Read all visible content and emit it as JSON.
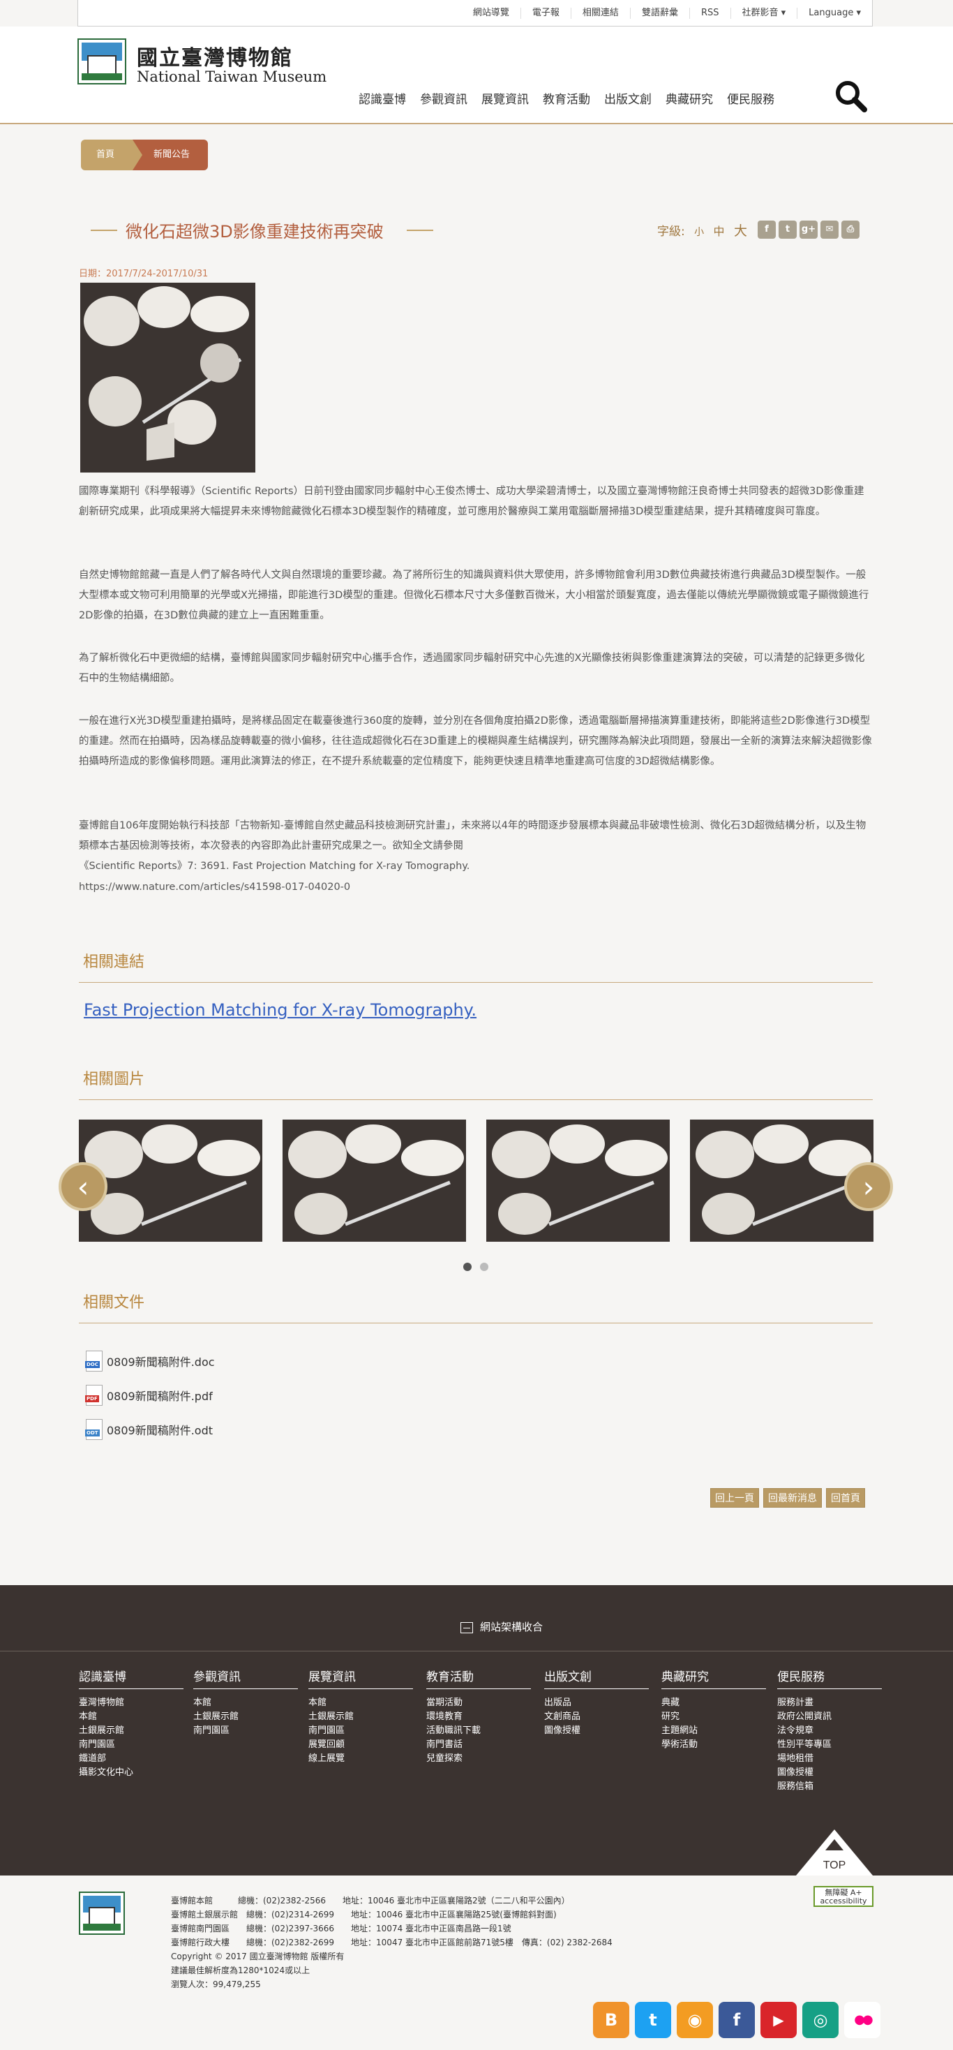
{
  "topbar": {
    "items": [
      "網站導覽",
      "電子報",
      "相關連結",
      "雙語辭彙",
      "RSS",
      "社群影音 ▾",
      "Language ▾"
    ]
  },
  "brand": {
    "name_cn": "國立臺灣博物館",
    "name_en": "National Taiwan Museum"
  },
  "nav": {
    "items": [
      "認識臺博",
      "參觀資訊",
      "展覽資訊",
      "教育活動",
      "出版文創",
      "典藏研究",
      "便民服務"
    ]
  },
  "breadcrumb": {
    "home": "首頁",
    "current": "新聞公告"
  },
  "article": {
    "title": "微化石超微3D影像重建技術再突破",
    "font_label": "字級:",
    "font_small": "小",
    "font_medium": "中",
    "font_large": "大",
    "date": "日期：2017/7/24-2017/10/31",
    "p1": "國際專業期刊《科學報導》（Scientific Reports）日前刊登由國家同步輻射中心王俊杰博士、成功大學梁碧清博士，以及國立臺灣博物館汪良奇博士共同發表的超微3D影像重建創新研究成果，此項成果將大幅提昇未來博物館藏微化石標本3D模型製作的精確度，並可應用於醫療與工業用電腦斷層掃描3D模型重建結果，提升其精確度與可靠度。",
    "p2": "自然史博物館館藏一直是人們了解各時代人文與自然環境的重要珍藏。為了將所衍生的知識與資料供大眾使用，許多博物館會利用3D數位典藏技術進行典藏品3D模型製作。一般大型標本或文物可利用簡單的光學或X光掃描，即能進行3D模型的重建。但微化石標本尺寸大多僅數百微米，大小相當於頭髮寬度，過去僅能以傳統光學顯微鏡或電子顯微鏡進行2D影像的拍攝，在3D數位典藏的建立上一直困難重重。",
    "p3": "為了解析微化石中更微細的結構，臺博館與國家同步輻射研究中心攜手合作，透過國家同步輻射研究中心先進的X光顯像技術與影像重建演算法的突破，可以清楚的記錄更多微化石中的生物結構細節。",
    "p4": "一般在進行X光3D模型重建拍攝時，是將樣品固定在載臺後進行360度的旋轉，並分別在各個角度拍攝2D影像，透過電腦斷層掃描演算重建技術，即能將這些2D影像進行3D模型的重建。然而在拍攝時，因為樣品旋轉載臺的微小偏移，往往造成超微化石在3D重建上的模糊與產生結構誤判，研究團隊為解決此項問題，發展出一全新的演算法來解決超微影像拍攝時所造成的影像偏移問題。運用此演算法的修正，在不提升系統載臺的定位精度下，能夠更快速且精準地重建高可信度的3D超微結構影像。",
    "p5": "臺博館自106年度開始執行科技部「古物新知-臺博館自然史藏品科技檢測研究計畫」，未來將以4年的時間逐步發展標本與藏品非破壞性檢測、微化石3D超微結構分析，以及生物類標本古基因檢測等技術，本次發表的內容即為此計畫研究成果之一。欲知全文請參閱",
    "ref": "《Scientific Reports》7: 3691. Fast Projection Matching for X-ray Tomography.",
    "url": "https://www.nature.com/articles/s41598-017-04020-0"
  },
  "related_links": {
    "heading": "相關連結",
    "items": [
      "Fast Projection Matching for X-ray Tomography."
    ]
  },
  "related_images": {
    "heading": "相關圖片"
  },
  "related_docs": {
    "heading": "相關文件",
    "items": [
      {
        "name": "0809新聞稿附件.doc",
        "type": "DOC",
        "color": "#2b6cc4"
      },
      {
        "name": "0809新聞稿附件.pdf",
        "type": "PDF",
        "color": "#d0312d"
      },
      {
        "name": "0809新聞稿附件.odt",
        "type": "ODT",
        "color": "#3a82c8"
      }
    ]
  },
  "page_nav": {
    "prev": "回上一頁",
    "list": "回最新消息",
    "home": "回首頁"
  },
  "footer": {
    "collapse": "網站架構收合",
    "columns": [
      {
        "title": "認識臺博",
        "items": [
          "臺灣博物館",
          "本館",
          "土銀展示館",
          "南門園區",
          "鐵道部",
          "攝影文化中心"
        ]
      },
      {
        "title": "參觀資訊",
        "items": [
          "本館",
          "土銀展示館",
          "南門園區"
        ]
      },
      {
        "title": "展覽資訊",
        "items": [
          "本館",
          "土銀展示館",
          "南門園區",
          "展覽回顧",
          "線上展覽"
        ]
      },
      {
        "title": "教育活動",
        "items": [
          "當期活動",
          "環境教育",
          "活動職訊下載",
          "南門書話",
          "兒童探索"
        ]
      },
      {
        "title": "出版文創",
        "items": [
          "出版品",
          "文創商品",
          "圖像授權"
        ]
      },
      {
        "title": "典藏研究",
        "items": [
          "典藏",
          "研究",
          "主題網站",
          "學術活動"
        ]
      },
      {
        "title": "便民服務",
        "items": [
          "服務計畫",
          "政府公開資訊",
          "法令規章",
          "性別平等專區",
          "場地租借",
          "圖像授權",
          "服務信箱"
        ]
      }
    ],
    "top_label": "TOP",
    "info": [
      "臺博館本館　　　總機：(02)2382-2566　　地址：10046 臺北市中正區襄陽路2號（二二八和平公園內）",
      "臺博館土銀展示館　總機：(02)2314-2699　　地址：10046 臺北市中正區襄陽路25號(臺博館斜對面)",
      "臺博館南門園區　　總機：(02)2397-3666　　地址：10074 臺北市中正區南昌路一段1號",
      "臺博館行政大樓　　總機：(02)2382-2699　　地址：10047 臺北市中正區館前路71號5樓　傳真：(02) 2382-2684",
      "Copyright © 2017 國立臺灣博物館 版權所有",
      "建議最佳解析度為1280*1024或以上",
      "瀏覽人次：99,479,255"
    ],
    "accessibility": "無障礙 A+ accessibility",
    "socials": [
      {
        "name": "blogger",
        "glyph": "B",
        "color": "#f0932b"
      },
      {
        "name": "twitter",
        "glyph": "t",
        "color": "#1da1f2"
      },
      {
        "name": "rss",
        "glyph": "◉",
        "color": "#f39c22"
      },
      {
        "name": "facebook",
        "glyph": "f",
        "color": "#3b5998"
      },
      {
        "name": "youtube",
        "glyph": "▶",
        "color": "#d9252a"
      },
      {
        "name": "tripadvisor",
        "glyph": "◎",
        "color": "#16a085"
      },
      {
        "name": "flickr",
        "glyph": "●●",
        "color": "#ffffff"
      }
    ]
  }
}
